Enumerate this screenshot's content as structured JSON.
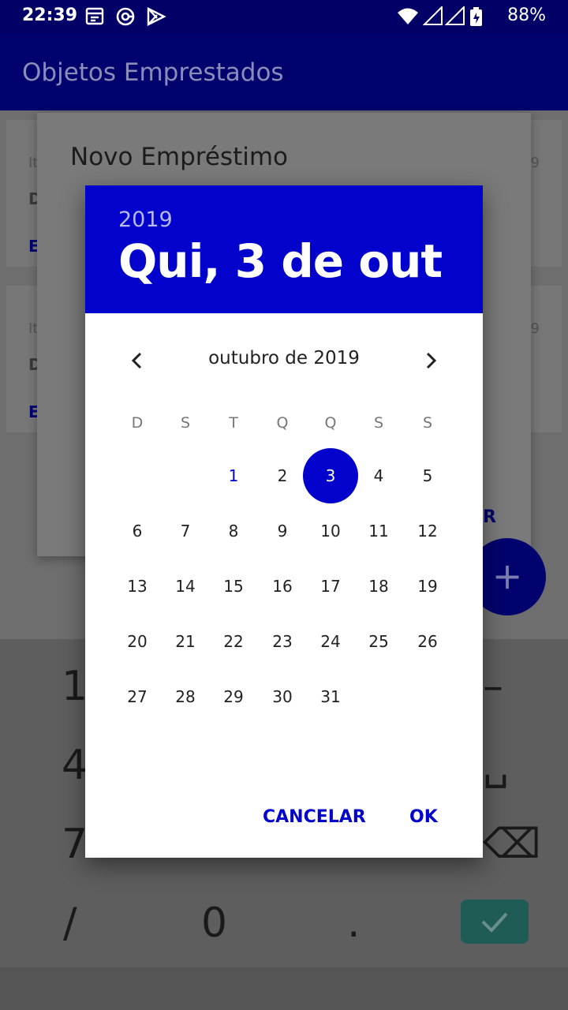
{
  "status_bar": {
    "time": "22:39",
    "battery": "88%",
    "icons_left": [
      "calendar-icon",
      "at-icon",
      "play-store-icon"
    ],
    "icons_right": [
      "wifi-icon",
      "signal-icon",
      "signal-icon-2",
      "battery-icon"
    ]
  },
  "app_bar": {
    "title": "Objetos Emprestados"
  },
  "background": {
    "cards": [
      {
        "line1": "It",
        "line2": "D",
        "line3": "E",
        "right": "9"
      },
      {
        "line1": "It",
        "line2": "D",
        "line3": "E",
        "right": "9"
      }
    ],
    "dialog": {
      "title": "Novo Empréstimo",
      "action": "AR"
    },
    "fab_symbol": "+",
    "keyboard": {
      "keys": [
        "1",
        "4",
        "7",
        "/",
        "0",
        ".",
        "–",
        "␣",
        "⌫"
      ]
    }
  },
  "date_picker": {
    "year": "2019",
    "selected_date": "Qui, 3 de out",
    "month_label": "outubro de 2019",
    "weekdays": [
      "D",
      "S",
      "T",
      "Q",
      "Q",
      "S",
      "S"
    ],
    "days": [
      "1",
      "2",
      "3",
      "4",
      "5",
      "6",
      "7",
      "8",
      "9",
      "10",
      "11",
      "12",
      "13",
      "14",
      "15",
      "16",
      "17",
      "18",
      "19",
      "20",
      "21",
      "22",
      "23",
      "24",
      "25",
      "26",
      "27",
      "28",
      "29",
      "30",
      "31"
    ],
    "first_weekday_index": 2,
    "selected_day": "3",
    "today_day": "1",
    "cancel_label": "CANCELAR",
    "ok_label": "OK",
    "colors": {
      "accent": "#0202cc",
      "app_bar": "#02026e"
    }
  }
}
